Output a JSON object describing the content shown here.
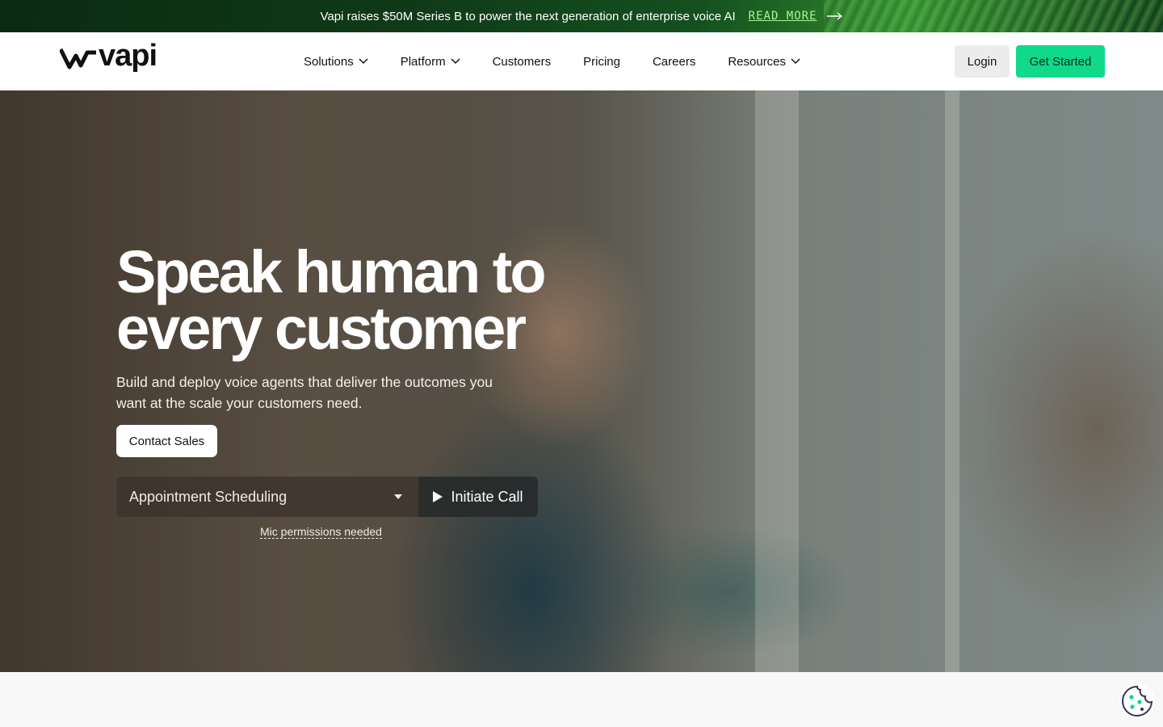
{
  "announcement": {
    "text": "Vapi raises $50M Series B to power the next generation of enterprise voice AI",
    "link_label": "READ MORE"
  },
  "header": {
    "logo_text": "vapi",
    "nav": [
      {
        "label": "Solutions",
        "has_dropdown": true
      },
      {
        "label": "Platform",
        "has_dropdown": true
      },
      {
        "label": "Customers",
        "has_dropdown": false
      },
      {
        "label": "Pricing",
        "has_dropdown": false
      },
      {
        "label": "Careers",
        "has_dropdown": false
      },
      {
        "label": "Resources",
        "has_dropdown": true
      }
    ],
    "login_label": "Login",
    "get_started_label": "Get Started"
  },
  "hero": {
    "title_line1": "Speak human to",
    "title_line2": "every customer",
    "subtitle": "Build and deploy voice agents that deliver the outcomes you want at the scale your customers need.",
    "contact_label": "Contact Sales",
    "use_case_selected": "Appointment Scheduling",
    "call_label": "Initiate Call",
    "mic_note": "Mic permissions needed"
  },
  "colors": {
    "accent_green": "#10d98a",
    "announce_green": "#0f3a18",
    "link_green": "#a9f59a"
  },
  "icons": {
    "logo": "vapi-wave-logo",
    "nav_dropdown": "chevron-down-icon",
    "announce_arrow": "arrow-right-icon",
    "select_caret": "caret-down-icon",
    "call": "play-icon",
    "cookie": "cookie-icon"
  }
}
